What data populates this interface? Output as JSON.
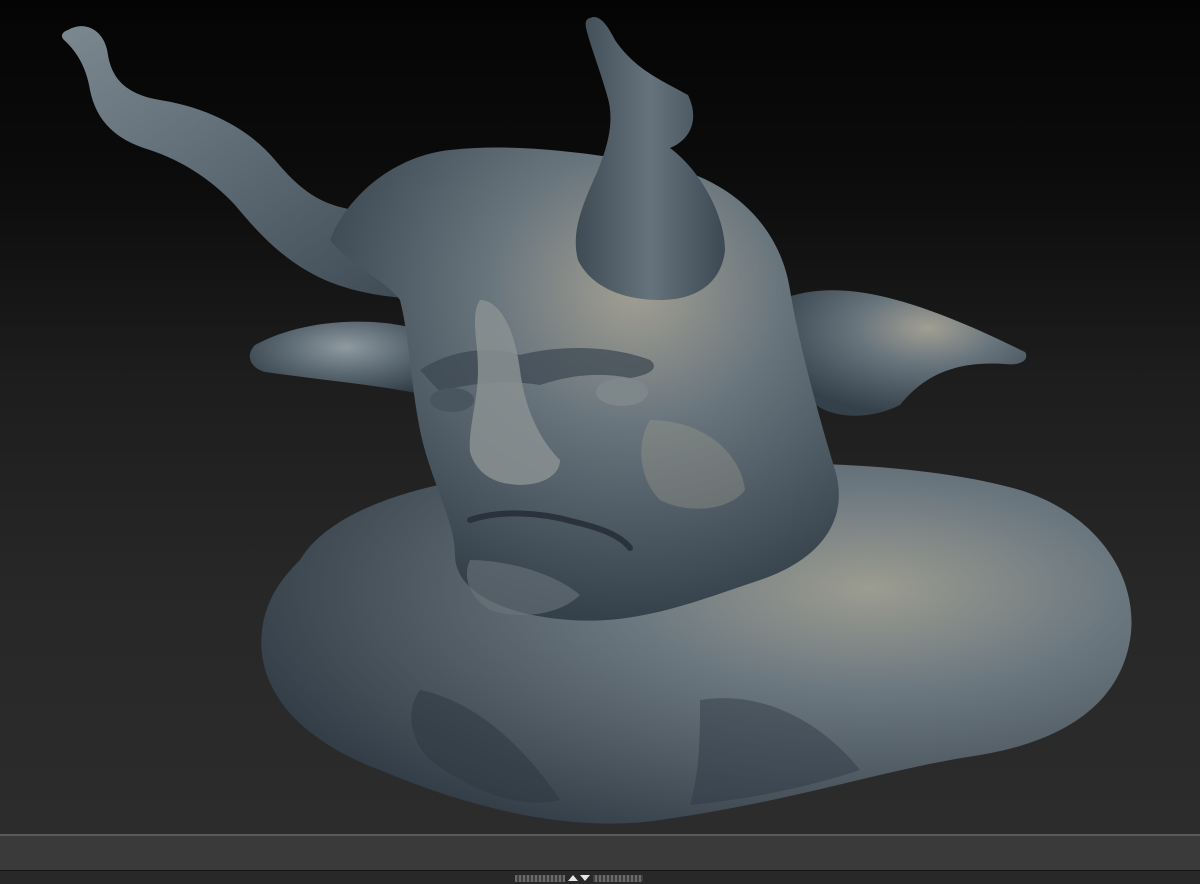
{
  "viewport": {
    "subject": "sculpted-demon-bust-model",
    "background_top": "#040404",
    "background_bottom": "#2c2c2c",
    "material_color": "#56656f"
  },
  "bottom_shelf": {
    "color": "#3a3a3a",
    "tray_handle_icons": [
      "arrow-up-icon",
      "arrow-down-icon"
    ]
  }
}
